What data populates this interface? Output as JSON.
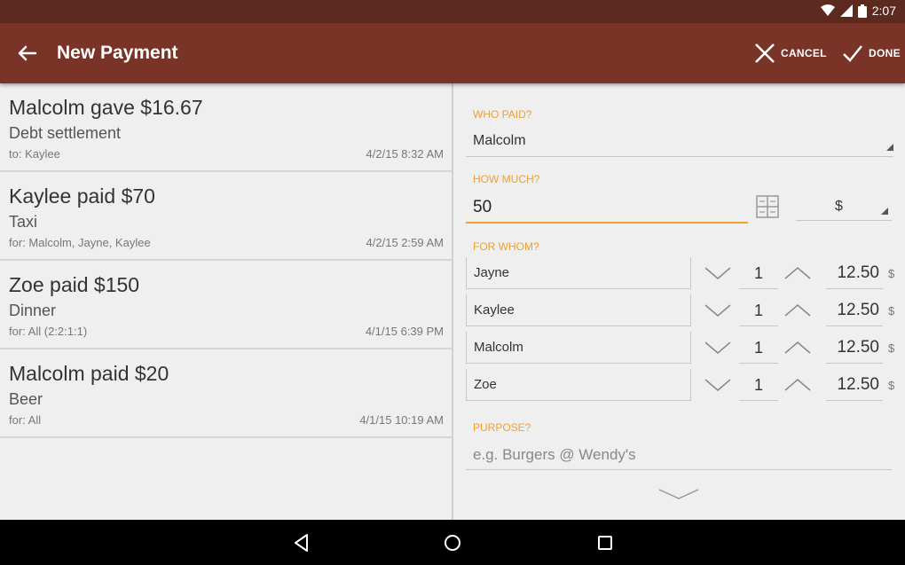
{
  "status_bar": {
    "time": "2:07",
    "icons": [
      "wifi-icon",
      "signal-icon",
      "battery-icon"
    ]
  },
  "app_bar": {
    "title": "New Payment",
    "cancel_label": "CANCEL",
    "done_label": "DONE"
  },
  "payments": [
    {
      "headline": "Malcolm gave $16.67",
      "purpose": "Debt settlement",
      "for": "to: Kaylee",
      "time": "4/2/15 8:32 AM"
    },
    {
      "headline": "Kaylee paid $70",
      "purpose": "Taxi",
      "for": "for: Malcolm, Jayne, Kaylee",
      "time": "4/2/15 2:59 AM"
    },
    {
      "headline": "Zoe paid $150",
      "purpose": "Dinner",
      "for": "for: All (2:2:1:1)",
      "time": "4/1/15 6:39 PM"
    },
    {
      "headline": "Malcolm paid $20",
      "purpose": "Beer",
      "for": "for: All",
      "time": "4/1/15 10:19 AM"
    }
  ],
  "form": {
    "who_paid_label": "WHO PAID?",
    "who_paid_value": "Malcolm",
    "how_much_label": "HOW MUCH?",
    "amount_value": "50",
    "currency": "$",
    "for_whom_label": "FOR WHOM?",
    "people": [
      {
        "name": "Jayne",
        "weight": "1",
        "share": "12.50",
        "currency": "$"
      },
      {
        "name": "Kaylee",
        "weight": "1",
        "share": "12.50",
        "currency": "$"
      },
      {
        "name": "Malcolm",
        "weight": "1",
        "share": "12.50",
        "currency": "$"
      },
      {
        "name": "Zoe",
        "weight": "1",
        "share": "12.50",
        "currency": "$"
      }
    ],
    "purpose_label": "PURPOSE?",
    "purpose_placeholder": "e.g. Burgers @ Wendy's"
  },
  "colors": {
    "app_bar": "#7a3427",
    "status_bar": "#5c2a1f",
    "accent": "#f0a030"
  }
}
